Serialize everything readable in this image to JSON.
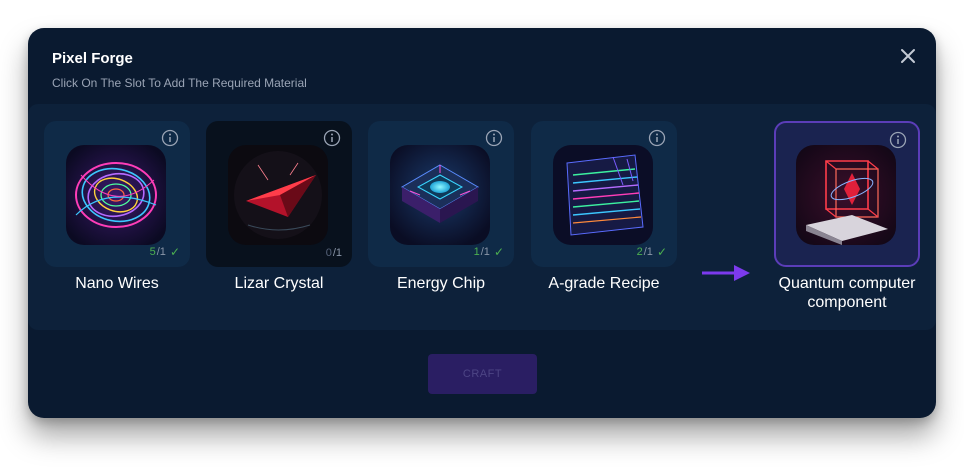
{
  "modal": {
    "title": "Pixel Forge",
    "subtitle": "Click On The Slot To Add The Required Material",
    "close_icon": "close-icon"
  },
  "materials": [
    {
      "name": "Nano Wires",
      "have": "5",
      "need": "/1",
      "complete": true
    },
    {
      "name": "Lizar Crystal",
      "have": "0",
      "need": "/1",
      "complete": false
    },
    {
      "name": "Energy Chip",
      "have": "1",
      "need": "/1",
      "complete": true
    },
    {
      "name": "A-grade Recipe",
      "have": "2",
      "need": "/1",
      "complete": true
    }
  ],
  "result": {
    "name": "Quantum computer component"
  },
  "craft_button": {
    "label": "CRAFT",
    "enabled": false
  },
  "colors": {
    "background": "#0a1a30",
    "panel": "#0d213a",
    "slot": "#0f2a47",
    "accent": "#7c3aed",
    "success": "#4caf50"
  }
}
